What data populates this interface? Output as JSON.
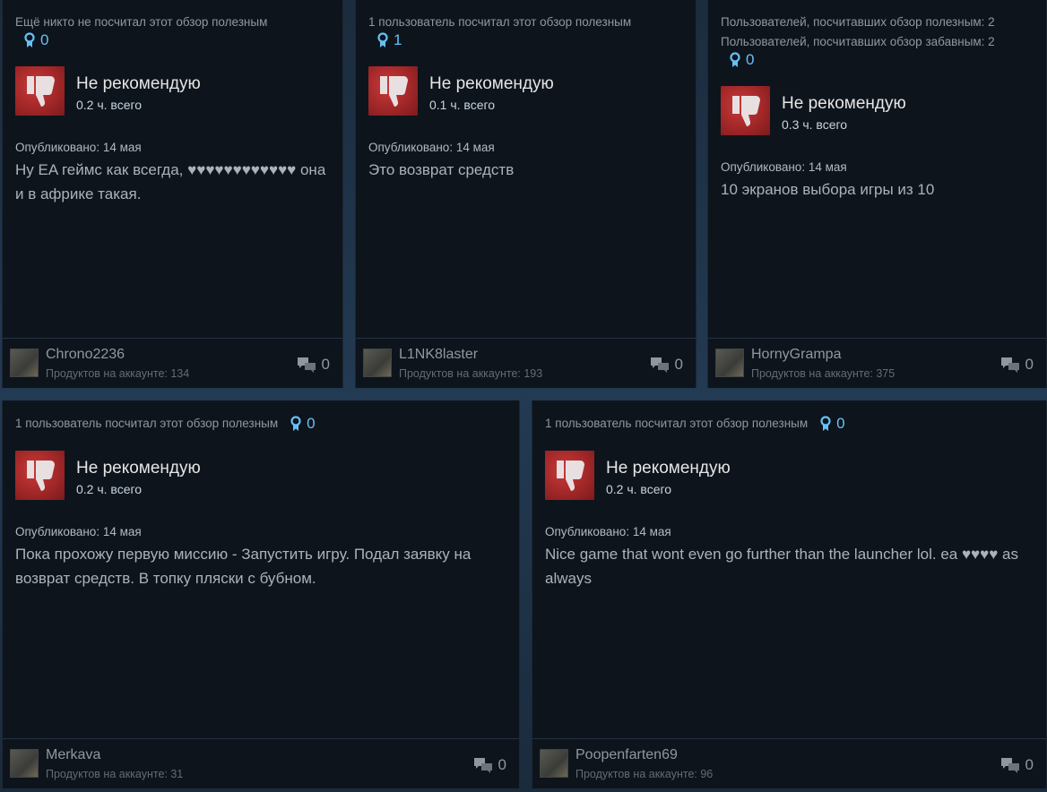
{
  "reviews": [
    {
      "votes": [
        "Ещё никто не посчитал этот обзор полезным"
      ],
      "awards": "0",
      "recommendation": "Не рекомендую",
      "hours": "0.2 ч. всего",
      "posted": "Опубликовано: 14 мая",
      "body": "Ну EA геймс как всегда, ♥♥♥♥♥♥♥♥♥♥♥♥ она и в африке такая.",
      "username": "Chrono2236",
      "products": "Продуктов на аккаунте: 134",
      "comments": "0"
    },
    {
      "votes": [
        "1 пользователь посчитал этот обзор полезным"
      ],
      "awards": "1",
      "recommendation": "Не рекомендую",
      "hours": "0.1 ч. всего",
      "posted": "Опубликовано: 14 мая",
      "body": "Это возврат средств",
      "username": "L1NK8laster",
      "products": "Продуктов на аккаунте: 193",
      "comments": "0"
    },
    {
      "votes": [
        "Пользователей, посчитавших обзор полезным: 2",
        "Пользователей, посчитавших обзор забавным: 2"
      ],
      "awards": "0",
      "recommendation": "Не рекомендую",
      "hours": "0.3 ч. всего",
      "posted": "Опубликовано: 14 мая",
      "body": "10 экранов выбора игры из 10",
      "username": "HornyGrampa",
      "products": "Продуктов на аккаунте: 375",
      "comments": "0"
    },
    {
      "votes": [
        "1 пользователь посчитал этот обзор полезным"
      ],
      "awards": "0",
      "recommendation": "Не рекомендую",
      "hours": "0.2 ч. всего",
      "posted": "Опубликовано: 14 мая",
      "body": "Пока прохожу первую миссию - Запустить игру. Подал заявку на возврат средств. В топку пляски с бубном.",
      "username": "Merkava",
      "products": "Продуктов на аккаунте: 31",
      "comments": "0"
    },
    {
      "votes": [
        "1 пользователь посчитал этот обзор полезным"
      ],
      "awards": "0",
      "recommendation": "Не рекомендую",
      "hours": "0.2 ч. всего",
      "posted": "Опубликовано: 14 мая",
      "body": "Nice game that wont even go further than the launcher lol. ea ♥♥♥♥ as always",
      "username": "Poopenfarten69",
      "products": "Продуктов на аккаунте: 96",
      "comments": "0"
    }
  ],
  "colors": {
    "accent": "#66c0f4",
    "thumb_down": "#a22728",
    "card_bg": "#0e141c"
  },
  "icons": {
    "award": "award-ribbon-icon",
    "thumb": "thumbs-down-icon",
    "comment": "comment-bubbles-icon"
  }
}
